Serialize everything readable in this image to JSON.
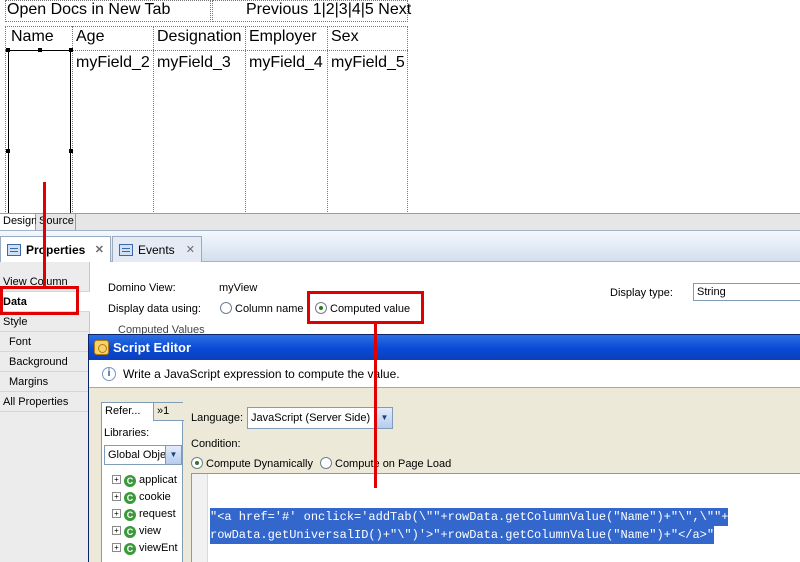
{
  "canvas": {
    "open_docs_label": "Open Docs in New Tab",
    "pager": "Previous 1|2|3|4|5 Next",
    "columns": [
      {
        "header": "Name",
        "field": ""
      },
      {
        "header": "Age",
        "field": "myField_2"
      },
      {
        "header": "Designation",
        "field": "myField_3"
      },
      {
        "header": "Employer",
        "field": "myField_4"
      },
      {
        "header": "Sex",
        "field": "myField_5"
      }
    ]
  },
  "editor_tabs": [
    "Design",
    "Source"
  ],
  "view_tabs": {
    "properties": "Properties",
    "events": "Events",
    "close_glyph": "✕"
  },
  "properties_nav": {
    "items": [
      "View Column",
      "Data",
      "Style",
      "Font",
      "Background",
      "Margins",
      "All Properties"
    ],
    "selected": "Data"
  },
  "data_panel": {
    "domino_view_label": "Domino View:",
    "domino_view_value": "myView",
    "display_using_label": "Display data using:",
    "radio_column_name": "Column name",
    "radio_computed_value": "Computed value",
    "radio_selected": "Computed value",
    "display_type_label": "Display type:",
    "display_type_value": "String",
    "computed_values_label": "Computed Values"
  },
  "script_editor": {
    "title": "Script Editor",
    "info_text": "Write a JavaScript expression to compute the value.",
    "reference_tab": "Refer...",
    "more_tab": "»1",
    "libraries_label": "Libraries:",
    "libraries_value": "Global Obje",
    "tree_items": [
      "applicat",
      "cookie",
      "request",
      "view",
      "viewEnt"
    ],
    "language_label": "Language:",
    "language_value": "JavaScript (Server Side)",
    "condition_label": "Condition:",
    "compute_dynamic_label": "Compute Dynamically",
    "compute_load_label": "Compute on Page Load",
    "condition_selected": "Compute Dynamically",
    "code_lines": [
      "\"<a href='#' onclick='addTab(\\\"\"+rowData.getColumnValue(\"Name\")+\"\\\",\\\"\"+",
      "rowData.getUniversalID()+\"\\\")'>\"+rowData.getColumnValue(\"Name\")+\"</a>\""
    ]
  },
  "colors": {
    "annotation_red": "#e10000",
    "title_bar_blue": "#0a4ad6",
    "selection_blue": "#3367cc"
  }
}
